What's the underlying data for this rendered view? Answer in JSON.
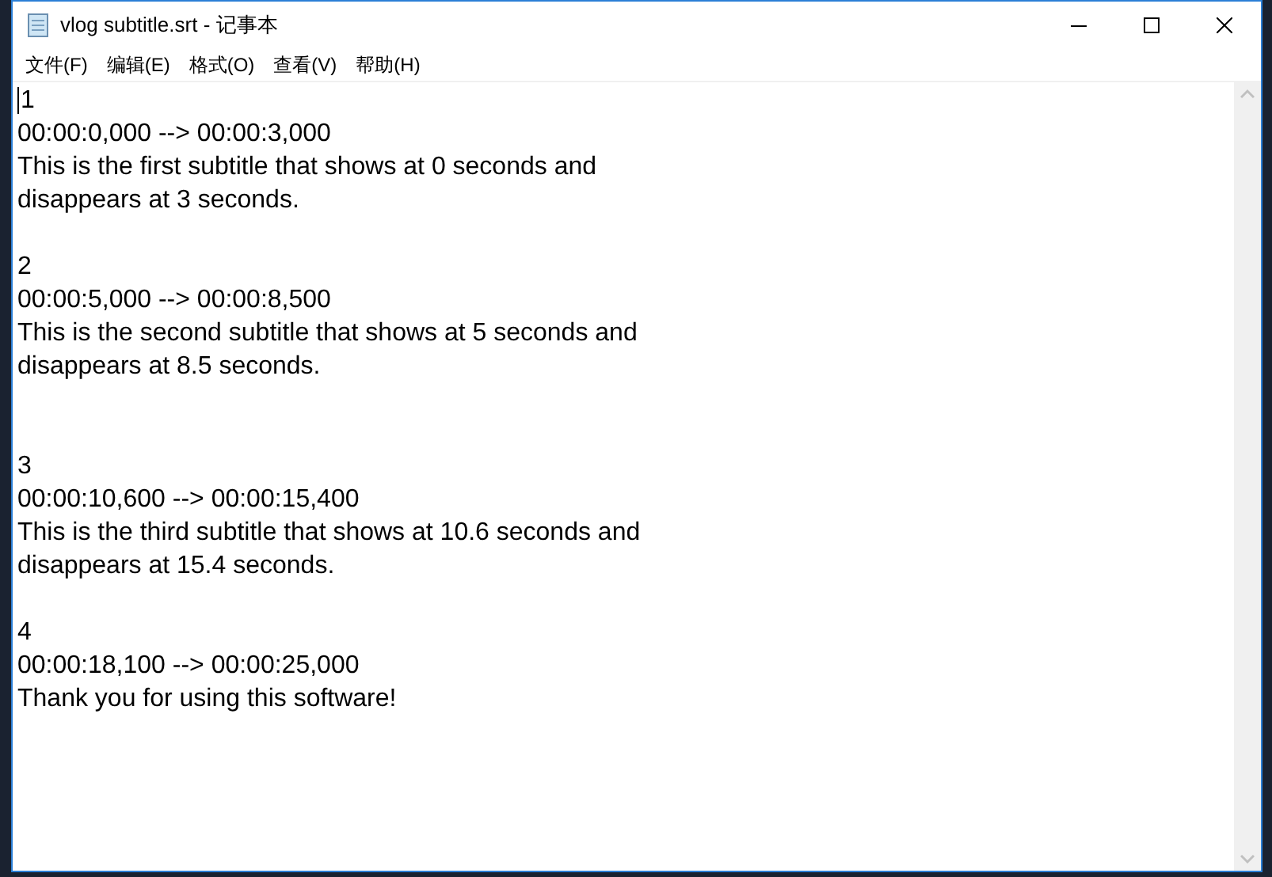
{
  "window": {
    "title": "vlog subtitle.srt - 记事本"
  },
  "menu": [
    "文件(F)",
    "编辑(E)",
    "格式(O)",
    "查看(V)",
    "帮助(H)"
  ],
  "entries": [
    {
      "index": "1",
      "time": "00:00:0,000 --> 00:00:3,000",
      "lines": [
        "This is the first subtitle that shows at 0 seconds and",
        "disappears at 3 seconds."
      ],
      "extra_blank_line": false
    },
    {
      "index": "2",
      "time": "00:00:5,000 --> 00:00:8,500",
      "lines": [
        "This is the second subtitle that shows at 5 seconds and",
        "disappears at 8.5 seconds."
      ],
      "extra_blank_line": true
    },
    {
      "index": "3",
      "time": "00:00:10,600 --> 00:00:15,400",
      "lines": [
        "This is the third subtitle that shows at 10.6 seconds and",
        "disappears at 15.4 seconds."
      ],
      "extra_blank_line": false
    },
    {
      "index": "4",
      "time": "00:00:18,100 --> 00:00:25,000",
      "lines": [
        "Thank you for using this software!"
      ],
      "extra_blank_line": false
    }
  ]
}
